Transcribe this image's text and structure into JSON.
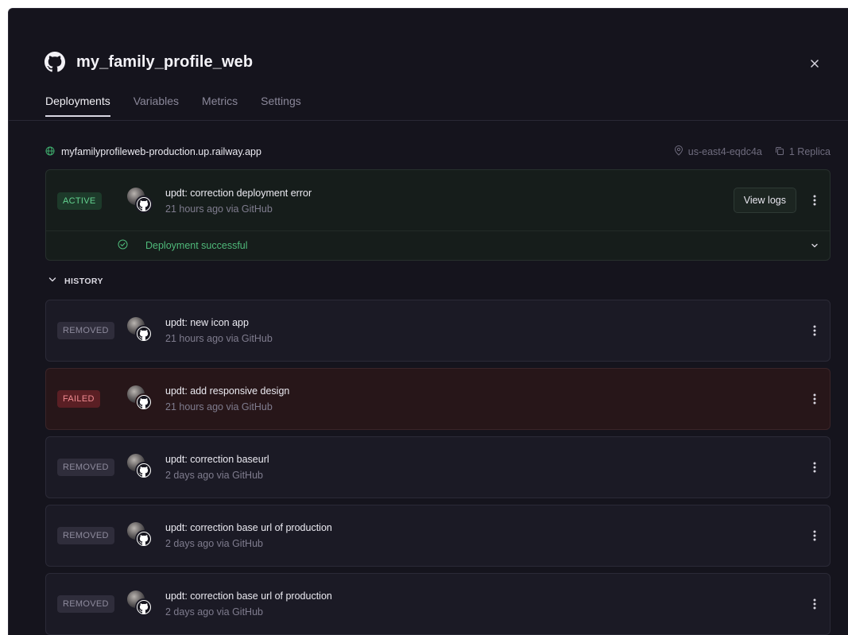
{
  "service": {
    "title": "my_family_profile_web"
  },
  "tabs": [
    {
      "label": "Deployments"
    },
    {
      "label": "Variables"
    },
    {
      "label": "Metrics"
    },
    {
      "label": "Settings"
    }
  ],
  "domain": {
    "url": "myfamilyprofileweb-production.up.railway.app",
    "region": "us-east4-eqdc4a",
    "replicas": "1 Replica"
  },
  "active_deployment": {
    "status": "ACTIVE",
    "message": "updt: correction deployment error",
    "time": "21 hours ago via GitHub",
    "view_logs_label": "View logs",
    "result": "Deployment successful"
  },
  "history": {
    "label": "HISTORY",
    "items": [
      {
        "status": "REMOVED",
        "message": "updt: new icon app",
        "time": "21 hours ago via GitHub"
      },
      {
        "status": "FAILED",
        "message": "updt: add responsive design",
        "time": "21 hours ago via GitHub"
      },
      {
        "status": "REMOVED",
        "message": "updt: correction baseurl",
        "time": "2 days ago via GitHub"
      },
      {
        "status": "REMOVED",
        "message": "updt: correction base url of production",
        "time": "2 days ago via GitHub"
      },
      {
        "status": "REMOVED",
        "message": "updt: correction base url of production",
        "time": "2 days ago via GitHub"
      }
    ]
  },
  "colors": {
    "background": "#15141d",
    "active": "#63d28f",
    "failed": "#f08a90",
    "removed": "#8e8b9d"
  }
}
